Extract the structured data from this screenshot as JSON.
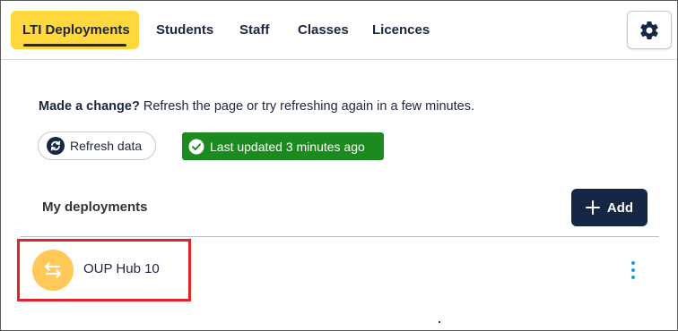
{
  "nav": {
    "tabs": [
      {
        "label": "LTI Deployments",
        "active": true
      },
      {
        "label": "Students",
        "active": false
      },
      {
        "label": "Staff",
        "active": false
      },
      {
        "label": "Classes",
        "active": false
      },
      {
        "label": "Licences",
        "active": false
      }
    ],
    "settings_icon": "gear-icon"
  },
  "notice": {
    "heading": "Made a change?",
    "text": "Refresh the page or try refreshing again in a few minutes."
  },
  "refresh": {
    "label": "Refresh data",
    "icon": "refresh-icon"
  },
  "status": {
    "label": "Last updated 3 minutes ago",
    "icon": "check-circle-icon",
    "color": "#1b8a1f"
  },
  "deployments": {
    "title": "My deployments",
    "add_label": "Add",
    "add_icon": "plus-icon",
    "items": [
      {
        "name": "OUP Hub 10",
        "icon": "swap-arrows-icon",
        "menu_icon": "more-vertical-icon"
      }
    ]
  },
  "colors": {
    "accent": "#ffd83d",
    "primary": "#152745",
    "highlight": "#e0242c",
    "kebab": "#1aa0d8",
    "avatar": "#ffc857"
  }
}
